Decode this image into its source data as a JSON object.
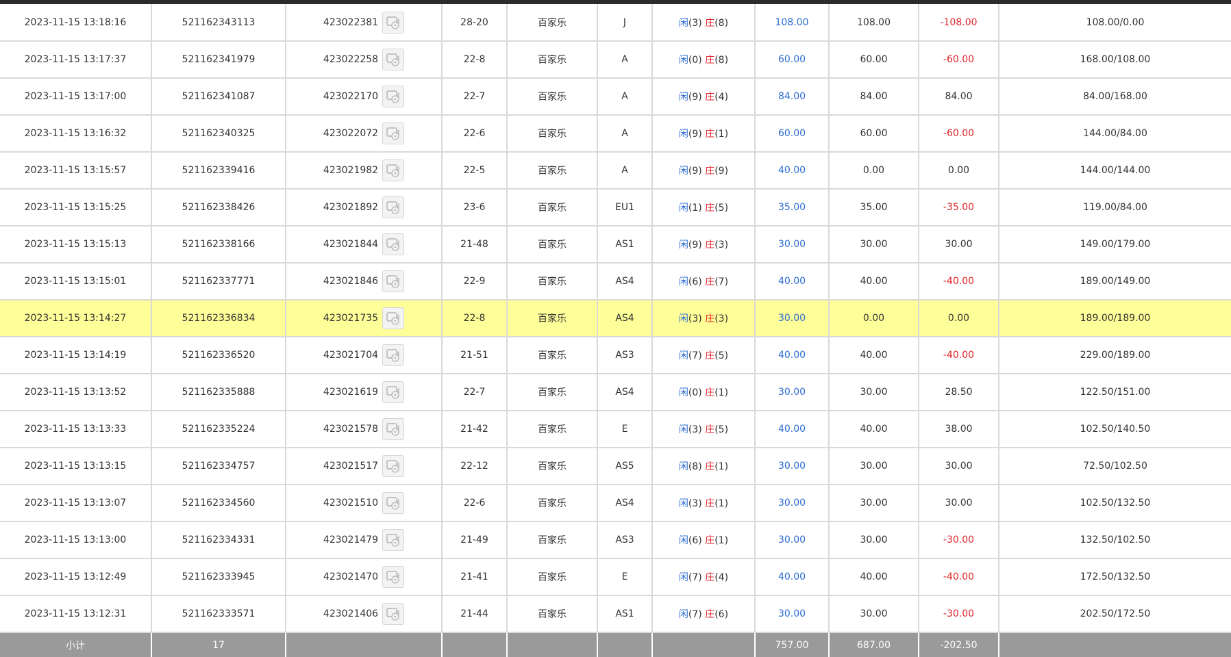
{
  "rows": [
    {
      "time": "2023-11-15 13:18:16",
      "order": "521162343113",
      "round": "423022381",
      "table": "28-20",
      "game": "百家乐",
      "hall": "J",
      "result": {
        "player_label": "闲",
        "player": "(3)",
        "banker_label": "庄",
        "banker": "(8)"
      },
      "bet": "108.00",
      "valid": "108.00",
      "win": "-108.00",
      "balance": "108.00/0.00"
    },
    {
      "time": "2023-11-15 13:17:37",
      "order": "521162341979",
      "round": "423022258",
      "table": "22-8",
      "game": "百家乐",
      "hall": "A",
      "result": {
        "player_label": "闲",
        "player": "(0)",
        "banker_label": "庄",
        "banker": "(8)"
      },
      "bet": "60.00",
      "valid": "60.00",
      "win": "-60.00",
      "balance": "168.00/108.00"
    },
    {
      "time": "2023-11-15 13:17:00",
      "order": "521162341087",
      "round": "423022170",
      "table": "22-7",
      "game": "百家乐",
      "hall": "A",
      "result": {
        "player_label": "闲",
        "player": "(9)",
        "banker_label": "庄",
        "banker": "(4)"
      },
      "bet": "84.00",
      "valid": "84.00",
      "win": "84.00",
      "balance": "84.00/168.00"
    },
    {
      "time": "2023-11-15 13:16:32",
      "order": "521162340325",
      "round": "423022072",
      "table": "22-6",
      "game": "百家乐",
      "hall": "A",
      "result": {
        "player_label": "闲",
        "player": "(9)",
        "banker_label": "庄",
        "banker": "(1)"
      },
      "bet": "60.00",
      "valid": "60.00",
      "win": "-60.00",
      "balance": "144.00/84.00"
    },
    {
      "time": "2023-11-15 13:15:57",
      "order": "521162339416",
      "round": "423021982",
      "table": "22-5",
      "game": "百家乐",
      "hall": "A",
      "result": {
        "player_label": "闲",
        "player": "(9)",
        "banker_label": "庄",
        "banker": "(9)"
      },
      "bet": "40.00",
      "valid": "0.00",
      "win": "0.00",
      "balance": "144.00/144.00"
    },
    {
      "time": "2023-11-15 13:15:25",
      "order": "521162338426",
      "round": "423021892",
      "table": "23-6",
      "game": "百家乐",
      "hall": "EU1",
      "result": {
        "player_label": "闲",
        "player": "(1)",
        "banker_label": "庄",
        "banker": "(5)"
      },
      "bet": "35.00",
      "valid": "35.00",
      "win": "-35.00",
      "balance": "119.00/84.00"
    },
    {
      "time": "2023-11-15 13:15:13",
      "order": "521162338166",
      "round": "423021844",
      "table": "21-48",
      "game": "百家乐",
      "hall": "AS1",
      "result": {
        "player_label": "闲",
        "player": "(9)",
        "banker_label": "庄",
        "banker": "(3)"
      },
      "bet": "30.00",
      "valid": "30.00",
      "win": "30.00",
      "balance": "149.00/179.00"
    },
    {
      "time": "2023-11-15 13:15:01",
      "order": "521162337771",
      "round": "423021846",
      "table": "22-9",
      "game": "百家乐",
      "hall": "AS4",
      "result": {
        "player_label": "闲",
        "player": "(6)",
        "banker_label": "庄",
        "banker": "(7)"
      },
      "bet": "40.00",
      "valid": "40.00",
      "win": "-40.00",
      "balance": "189.00/149.00"
    },
    {
      "time": "2023-11-15 13:14:27",
      "order": "521162336834",
      "round": "423021735",
      "table": "22-8",
      "game": "百家乐",
      "hall": "AS4",
      "result": {
        "player_label": "闲",
        "player": "(3)",
        "banker_label": "庄",
        "banker": "(3)"
      },
      "bet": "30.00",
      "valid": "0.00",
      "win": "0.00",
      "balance": "189.00/189.00",
      "highlight": true
    },
    {
      "time": "2023-11-15 13:14:19",
      "order": "521162336520",
      "round": "423021704",
      "table": "21-51",
      "game": "百家乐",
      "hall": "AS3",
      "result": {
        "player_label": "闲",
        "player": "(7)",
        "banker_label": "庄",
        "banker": "(5)"
      },
      "bet": "40.00",
      "valid": "40.00",
      "win": "-40.00",
      "balance": "229.00/189.00"
    },
    {
      "time": "2023-11-15 13:13:52",
      "order": "521162335888",
      "round": "423021619",
      "table": "22-7",
      "game": "百家乐",
      "hall": "AS4",
      "result": {
        "player_label": "闲",
        "player": "(0)",
        "banker_label": "庄",
        "banker": "(1)"
      },
      "bet": "30.00",
      "valid": "30.00",
      "win": "28.50",
      "balance": "122.50/151.00"
    },
    {
      "time": "2023-11-15 13:13:33",
      "order": "521162335224",
      "round": "423021578",
      "table": "21-42",
      "game": "百家乐",
      "hall": "E",
      "result": {
        "player_label": "闲",
        "player": "(3)",
        "banker_label": "庄",
        "banker": "(5)"
      },
      "bet": "40.00",
      "valid": "40.00",
      "win": "38.00",
      "balance": "102.50/140.50"
    },
    {
      "time": "2023-11-15 13:13:15",
      "order": "521162334757",
      "round": "423021517",
      "table": "22-12",
      "game": "百家乐",
      "hall": "AS5",
      "result": {
        "player_label": "闲",
        "player": "(8)",
        "banker_label": "庄",
        "banker": "(1)"
      },
      "bet": "30.00",
      "valid": "30.00",
      "win": "30.00",
      "balance": "72.50/102.50"
    },
    {
      "time": "2023-11-15 13:13:07",
      "order": "521162334560",
      "round": "423021510",
      "table": "22-6",
      "game": "百家乐",
      "hall": "AS4",
      "result": {
        "player_label": "闲",
        "player": "(3)",
        "banker_label": "庄",
        "banker": "(1)"
      },
      "bet": "30.00",
      "valid": "30.00",
      "win": "30.00",
      "balance": "102.50/132.50"
    },
    {
      "time": "2023-11-15 13:13:00",
      "order": "521162334331",
      "round": "423021479",
      "table": "21-49",
      "game": "百家乐",
      "hall": "AS3",
      "result": {
        "player_label": "闲",
        "player": "(6)",
        "banker_label": "庄",
        "banker": "(1)"
      },
      "bet": "30.00",
      "valid": "30.00",
      "win": "-30.00",
      "balance": "132.50/102.50"
    },
    {
      "time": "2023-11-15 13:12:49",
      "order": "521162333945",
      "round": "423021470",
      "table": "21-41",
      "game": "百家乐",
      "hall": "E",
      "result": {
        "player_label": "闲",
        "player": "(7)",
        "banker_label": "庄",
        "banker": "(4)"
      },
      "bet": "40.00",
      "valid": "40.00",
      "win": "-40.00",
      "balance": "172.50/132.50"
    },
    {
      "time": "2023-11-15 13:12:31",
      "order": "521162333571",
      "round": "423021406",
      "table": "21-44",
      "game": "百家乐",
      "hall": "AS1",
      "result": {
        "player_label": "闲",
        "player": "(7)",
        "banker_label": "庄",
        "banker": "(6)"
      },
      "bet": "30.00",
      "valid": "30.00",
      "win": "-30.00",
      "balance": "202.50/172.50"
    }
  ],
  "subtotal": {
    "label": "小计",
    "count": "17",
    "bet": "757.00",
    "valid": "687.00",
    "win": "-202.50"
  },
  "colors": {
    "player": "#2a6bd2",
    "banker": "#e0262b",
    "loss": "#e0262b",
    "highlight": "#ffff99",
    "subtotal_bg": "#9a9a9a"
  },
  "icons": {
    "replay": "replay-video-icon"
  }
}
